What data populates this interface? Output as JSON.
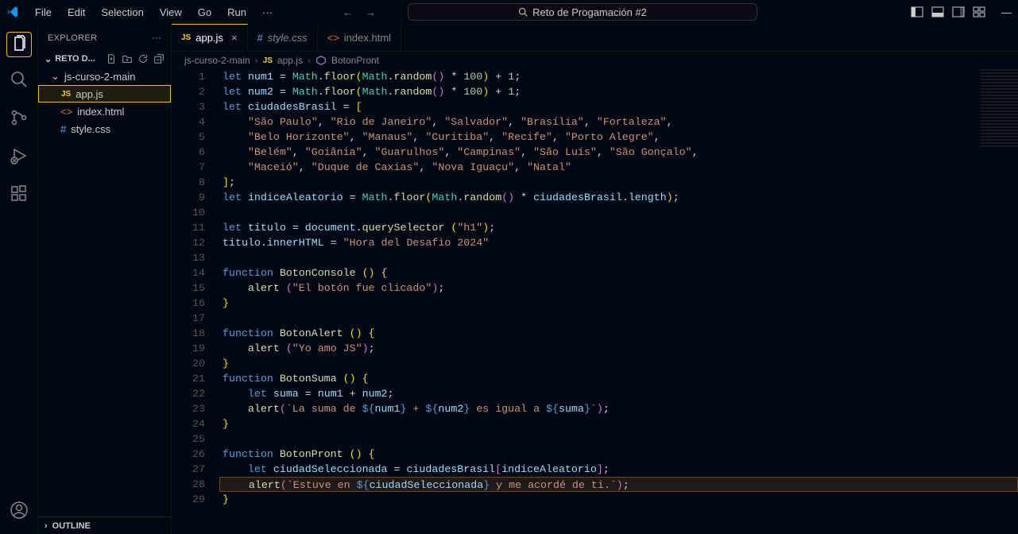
{
  "menu": [
    "File",
    "Edit",
    "Selection",
    "View",
    "Go",
    "Run",
    "···"
  ],
  "searchTitle": "Reto de Progamación #2",
  "explorer": {
    "header": "EXPLORER",
    "sectionTitle": "RETO D...",
    "folder": "js-curso-2-main",
    "files": [
      {
        "name": "app.js",
        "icon": "js",
        "selected": true
      },
      {
        "name": "index.html",
        "icon": "html",
        "selected": false
      },
      {
        "name": "style.css",
        "icon": "css",
        "selected": false
      }
    ],
    "outline": "OUTLINE"
  },
  "tabs": [
    {
      "name": "app.js",
      "icon": "js",
      "active": true,
      "close": true
    },
    {
      "name": "style.css",
      "icon": "css",
      "active": false,
      "italic": true
    },
    {
      "name": "index.html",
      "icon": "html",
      "active": false
    }
  ],
  "breadcrumb": {
    "parts": [
      "js-curso-2-main",
      "app.js",
      "BotonPront"
    ],
    "icons": [
      "",
      "js",
      "fn"
    ]
  },
  "code": {
    "lines": [
      {
        "n": 1,
        "html": "<span class='kw'>let</span> <span class='var'>num1</span> <span class='op'>=</span> <span class='obj'>Math</span>.<span class='fn'>floor</span><span class='brace'>(</span><span class='obj'>Math</span>.<span class='fn'>random</span><span class='brace2'>()</span> <span class='op'>*</span> <span class='num'>100</span><span class='brace'>)</span> <span class='op'>+</span> <span class='num'>1</span>;"
      },
      {
        "n": 2,
        "html": "<span class='kw'>let</span> <span class='var'>num2</span> <span class='op'>=</span> <span class='obj'>Math</span>.<span class='fn'>floor</span><span class='brace'>(</span><span class='obj'>Math</span>.<span class='fn'>random</span><span class='brace2'>()</span> <span class='op'>*</span> <span class='num'>100</span><span class='brace'>)</span> <span class='op'>+</span> <span class='num'>1</span>;"
      },
      {
        "n": 3,
        "html": "<span class='kw'>let</span> <span class='var'>ciudadesBrasil</span> <span class='op'>=</span> <span class='brace'>[</span>"
      },
      {
        "n": 4,
        "html": "    <span class='str'>\"São Paulo\"</span>, <span class='str'>\"Rio de Janeiro\"</span>, <span class='str'>\"Salvador\"</span>, <span class='str'>\"Brasília\"</span>, <span class='str'>\"Fortaleza\"</span>,"
      },
      {
        "n": 5,
        "html": "    <span class='str'>\"Belo Horizonte\"</span>, <span class='str'>\"Manaus\"</span>, <span class='str'>\"Curitiba\"</span>, <span class='str'>\"Recife\"</span>, <span class='str'>\"Porto Alegre\"</span>,"
      },
      {
        "n": 6,
        "html": "    <span class='str'>\"Belém\"</span>, <span class='str'>\"Goiânia\"</span>, <span class='str'>\"Guarulhos\"</span>, <span class='str'>\"Campinas\"</span>, <span class='str'>\"São Luís\"</span>, <span class='str'>\"São Gonçalo\"</span>,"
      },
      {
        "n": 7,
        "html": "    <span class='str'>\"Maceió\"</span>, <span class='str'>\"Duque de Caxias\"</span>, <span class='str'>\"Nova Iguaçu\"</span>, <span class='str'>\"Natal\"</span>"
      },
      {
        "n": 8,
        "html": "<span class='brace'>]</span>;"
      },
      {
        "n": 9,
        "html": "<span class='kw'>let</span> <span class='var'>indiceAleatorio</span> <span class='op'>=</span> <span class='obj'>Math</span>.<span class='fn'>floor</span><span class='brace'>(</span><span class='obj'>Math</span>.<span class='fn'>random</span><span class='brace2'>()</span> <span class='op'>*</span> <span class='var'>ciudadesBrasil</span>.<span class='var'>length</span><span class='brace'>)</span>;"
      },
      {
        "n": 10,
        "html": ""
      },
      {
        "n": 11,
        "html": "<span class='kw'>let</span> <span class='var'>titulo</span> <span class='op'>=</span> <span class='var'>document</span>.<span class='fn'>querySelector</span> <span class='brace'>(</span><span class='str'>\"h1\"</span><span class='brace'>)</span>;"
      },
      {
        "n": 12,
        "html": "<span class='var'>titulo</span>.<span class='var'>innerHTML</span> <span class='op'>=</span> <span class='str'>\"Hora del Desafio 2024\"</span>"
      },
      {
        "n": 13,
        "html": ""
      },
      {
        "n": 14,
        "html": "<span class='kw'>function</span> <span class='fn'>BotonConsole</span> <span class='brace'>()</span> <span class='brace'>{</span>"
      },
      {
        "n": 15,
        "html": "    <span class='fn'>alert</span> <span class='brace2'>(</span><span class='str'>\"El botón fue clicado\"</span><span class='brace2'>)</span>;"
      },
      {
        "n": 16,
        "html": "<span class='brace'>}</span>"
      },
      {
        "n": 17,
        "html": ""
      },
      {
        "n": 18,
        "html": "<span class='kw'>function</span> <span class='fn'>BotonAlert</span> <span class='brace'>()</span> <span class='brace'>{</span>"
      },
      {
        "n": 19,
        "html": "    <span class='fn'>alert</span> <span class='brace2'>(</span><span class='str'>\"Yo amo JS\"</span><span class='brace2'>)</span>;"
      },
      {
        "n": 20,
        "html": "<span class='brace'>}</span>"
      },
      {
        "n": 21,
        "html": "<span class='kw'>function</span> <span class='fn'>BotonSuma</span> <span class='brace'>()</span> <span class='brace'>{</span>"
      },
      {
        "n": 22,
        "html": "    <span class='kw'>let</span> <span class='var'>suma</span> <span class='op'>=</span> <span class='var'>num1</span> <span class='op'>+</span> <span class='var'>num2</span>;"
      },
      {
        "n": 23,
        "html": "    <span class='fn'>alert</span><span class='brace2'>(</span><span class='str'>`La suma de </span><span class='kw'>${</span><span class='var'>num1</span><span class='kw'>}</span><span class='str'> + </span><span class='kw'>${</span><span class='var'>num2</span><span class='kw'>}</span><span class='str'> es igual a </span><span class='kw'>${</span><span class='var'>suma</span><span class='kw'>}</span><span class='str'>`</span><span class='brace2'>)</span>;"
      },
      {
        "n": 24,
        "html": "<span class='brace'>}</span>"
      },
      {
        "n": 25,
        "html": ""
      },
      {
        "n": 26,
        "html": "<span class='kw'>function</span> <span class='fn'>BotonPront</span> <span class='brace'>()</span> <span class='brace'>{</span>"
      },
      {
        "n": 27,
        "html": "    <span class='kw'>let</span> <span class='var'>ciudadSeleccionada</span> <span class='op'>=</span> <span class='var'>ciudadesBrasil</span><span class='brace2'>[</span><span class='var'>indiceAleatorio</span><span class='brace2'>]</span>;"
      },
      {
        "n": 28,
        "hl": true,
        "html": "    <span class='fn'>alert</span><span class='brace2'>(</span><span class='str'>`Estuve en </span><span class='kw'>${</span><span class='var'>ciudadSeleccionada</span><span class='kw'>}</span><span class='str'> y me acordé de ti.`</span><span class='brace2'>)</span>;"
      },
      {
        "n": 29,
        "html": "<span class='brace'>}</span>"
      }
    ]
  }
}
